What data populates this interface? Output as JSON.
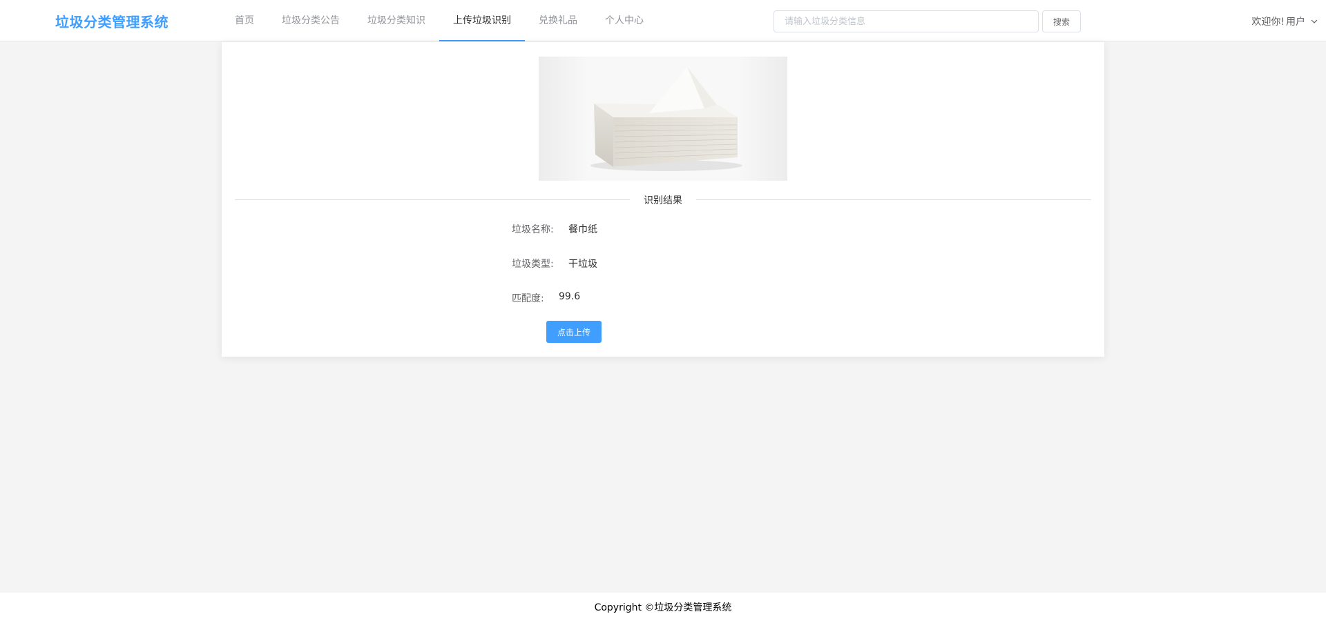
{
  "header": {
    "logo": "垃圾分类管理系统",
    "nav": [
      {
        "label": "首页"
      },
      {
        "label": "垃圾分类公告"
      },
      {
        "label": "垃圾分类知识"
      },
      {
        "label": "上传垃圾识别"
      },
      {
        "label": "兑换礼品"
      },
      {
        "label": "个人中心"
      }
    ],
    "active_nav": "上传垃圾识别",
    "search": {
      "placeholder": "请输入垃圾分类信息",
      "value": "",
      "button_label": "搜索"
    },
    "user": {
      "greeting": "欢迎你!",
      "name": "用户",
      "dropdown_icon": "chevron-down-icon"
    }
  },
  "result": {
    "image_alt": "餐巾纸",
    "section_title": "识别结果",
    "name_label": "垃圾名称:",
    "name_value": "餐巾纸",
    "type_label": "垃圾类型:",
    "type_value": "干垃圾",
    "match_label": "匹配度:",
    "match_value": "99.6",
    "upload_button": "点击上传"
  },
  "footer": {
    "copyright": "Copyright ©垃圾分类管理系统"
  },
  "colors": {
    "accent": "#409eff",
    "page_bg": "#f4f4f4",
    "card_bg": "#ffffff"
  }
}
